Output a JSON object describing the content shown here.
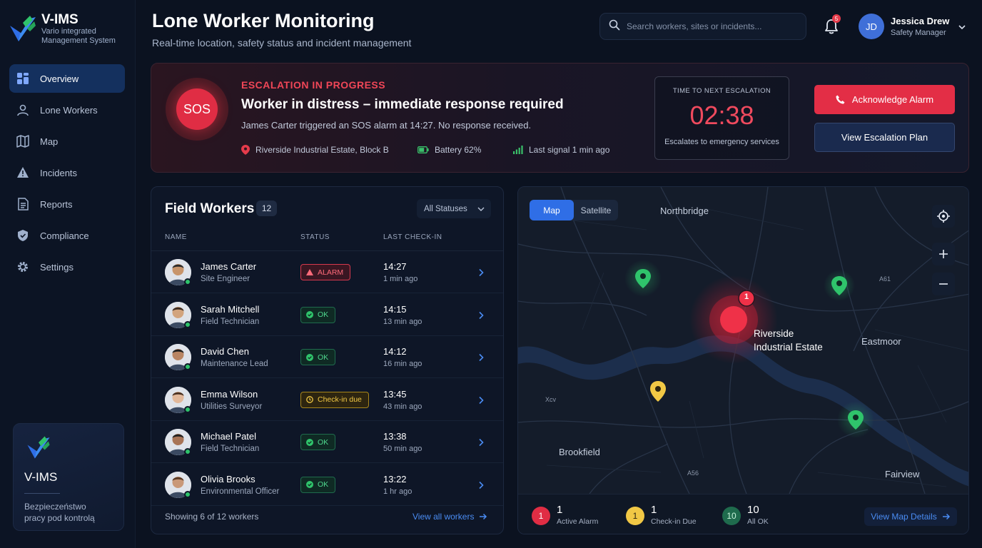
{
  "brand": {
    "name": "V-IMS",
    "subtitle_line1": "Vario integrated",
    "subtitle_line2": "Management System"
  },
  "sidebar": {
    "items": [
      {
        "label": "Overview",
        "icon": "dashboard-icon",
        "active": true
      },
      {
        "label": "Lone Workers",
        "icon": "user-icon",
        "active": false
      },
      {
        "label": "Map",
        "icon": "map-icon",
        "active": false
      },
      {
        "label": "Incidents",
        "icon": "warning-icon",
        "active": false
      },
      {
        "label": "Reports",
        "icon": "document-icon",
        "active": false
      },
      {
        "label": "Compliance",
        "icon": "shield-icon",
        "active": false
      },
      {
        "label": "Settings",
        "icon": "gear-icon",
        "active": false
      }
    ],
    "promo": {
      "title": "V-IMS",
      "text_line1": "Bezpieczeństwo",
      "text_line2": "pracy pod kontrolą"
    }
  },
  "header": {
    "title": "Lone Worker Monitoring",
    "subtitle": "Real-time location, safety status and incident management",
    "search_placeholder": "Search workers, sites or incidents...",
    "notification_count": "5",
    "user": {
      "initials": "JD",
      "name": "Jessica Drew",
      "role": "Safety Manager"
    }
  },
  "alert": {
    "sos_label": "SOS",
    "tag": "ESCALATION IN PROGRESS",
    "title": "Worker in distress – immediate response required",
    "description": "James Carter triggered an SOS alarm at 14:27. No response received.",
    "location": "Riverside Industrial Estate, Block B",
    "battery": "Battery 62%",
    "signal": "Last signal 1 min ago",
    "escalation_label": "TIME TO NEXT ESCALATION",
    "escalation_time": "02:38",
    "escalation_sub": "Escalates to emergency services",
    "acknowledge_label": "Acknowledge Alarm",
    "plan_label": "View Escalation Plan",
    "colors": {
      "danger": "#e32e46",
      "ok": "#4fd88e",
      "warning": "#f1c845",
      "accent": "#2f6ee6"
    }
  },
  "workers": {
    "title": "Field Workers",
    "count": "12",
    "filter": "All Statuses",
    "columns": {
      "name": "NAME",
      "status": "STATUS",
      "checkin": "LAST CHECK-IN"
    },
    "rows": [
      {
        "name": "James Carter",
        "role": "Site Engineer",
        "status": "ALARM",
        "status_type": "alarm",
        "time": "14:27",
        "ago": "1 min ago"
      },
      {
        "name": "Sarah Mitchell",
        "role": "Field Technician",
        "status": "OK",
        "status_type": "ok",
        "time": "14:15",
        "ago": "13 min ago"
      },
      {
        "name": "David Chen",
        "role": "Maintenance Lead",
        "status": "OK",
        "status_type": "ok",
        "time": "14:12",
        "ago": "16 min ago"
      },
      {
        "name": "Emma Wilson",
        "role": "Utilities Surveyor",
        "status": "Check-in due",
        "status_type": "due",
        "time": "13:45",
        "ago": "43 min ago"
      },
      {
        "name": "Michael Patel",
        "role": "Field Technician",
        "status": "OK",
        "status_type": "ok",
        "time": "13:38",
        "ago": "50 min ago"
      },
      {
        "name": "Olivia Brooks",
        "role": "Environmental Officer",
        "status": "OK",
        "status_type": "ok",
        "time": "13:22",
        "ago": "1 hr ago"
      }
    ],
    "footer": "Showing 6 of 12 workers",
    "view_all": "View all workers"
  },
  "map": {
    "tabs": [
      "Map",
      "Satellite"
    ],
    "active_tab": "Map",
    "labels": {
      "north": "Northbridge",
      "riverside_1": "Riverside",
      "riverside_2": "Industrial Estate",
      "east": "Eastmoor",
      "brook": "Brookfield",
      "fair": "Fairview",
      "road_a": "A61",
      "road_b": "A56",
      "road_c": "Xcv"
    },
    "alarm_marker_count": "1",
    "summary": [
      {
        "num": "1",
        "label": "Active Alarm",
        "color": "#e02d44"
      },
      {
        "num": "1",
        "label": "Check-in Due",
        "color": "#f1c845"
      },
      {
        "num": "10",
        "label": "All OK",
        "color": "#1f6b4d"
      }
    ],
    "details_link": "View Map Details"
  }
}
